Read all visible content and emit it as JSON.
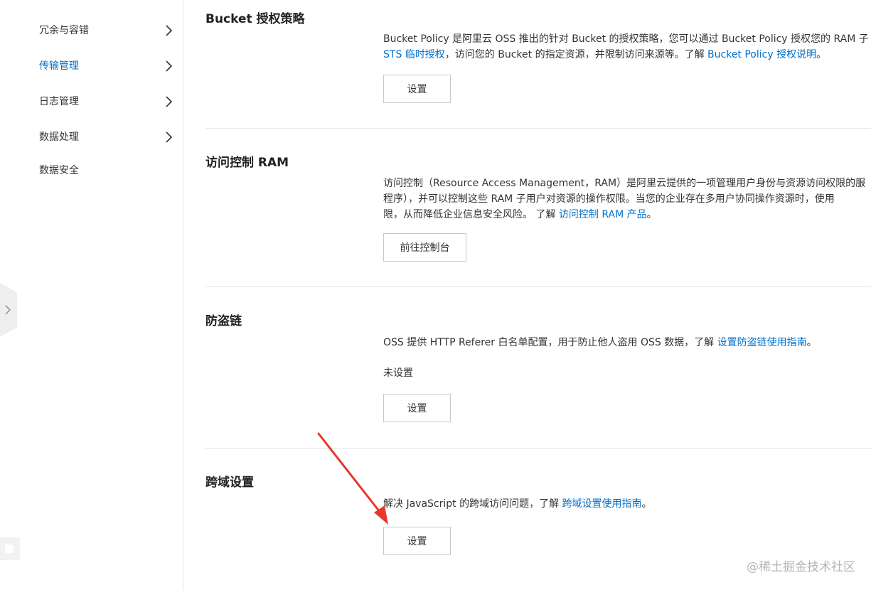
{
  "sidebar": {
    "items": [
      {
        "label": "冗余与容错",
        "has_chevron": true,
        "active": false
      },
      {
        "label": "传输管理",
        "has_chevron": true,
        "active": true
      },
      {
        "label": "日志管理",
        "has_chevron": true,
        "active": false
      },
      {
        "label": "数据处理",
        "has_chevron": true,
        "active": false
      },
      {
        "label": "数据安全",
        "has_chevron": false,
        "active": false
      }
    ]
  },
  "sections": {
    "bucket_policy": {
      "title": "Bucket 授权策略",
      "desc_line1": "Bucket Policy 是阿里云 OSS 推出的针对 Bucket 的授权策略，您可以通过 Bucket Policy 授权您的 RAM 子",
      "desc_link1": "STS 临时授权",
      "desc_line2": "，访问您的 Bucket 的指定资源，并限制访问来源等。了解 ",
      "desc_link2": "Bucket Policy 授权说明",
      "desc_end": "。",
      "button": "设置"
    },
    "ram": {
      "title": "访问控制 RAM",
      "desc_line1": "访问控制（Resource Access Management，RAM）是阿里云提供的一项管理用户身份与资源访问权限的服",
      "desc_line2": "程序），并可以控制这些 RAM 子用户对资源的操作权限。当您的企业存在多用户协同操作资源时，使用",
      "desc_line3": "限，从而降低企业信息安全风险。 了解 ",
      "desc_link": "访问控制 RAM 产品",
      "desc_end": "。",
      "button": "前往控制台"
    },
    "hotlink": {
      "title": "防盗链",
      "desc": "OSS 提供 HTTP Referer 白名单配置，用于防止他人盗用 OSS 数据，了解 ",
      "desc_link": "设置防盗链使用指南",
      "desc_end": "。",
      "status": "未设置",
      "button": "设置"
    },
    "cors": {
      "title": "跨域设置",
      "desc": "解决 JavaScript 的跨域访问问题，了解 ",
      "desc_link": "跨域设置使用指南",
      "desc_end": "。",
      "button": "设置"
    }
  },
  "annotation": {
    "arrow_color": "#e8372d"
  },
  "watermark": "@稀土掘金技术社区",
  "colors": {
    "link": "#0070cc",
    "active_nav": "#0070cc"
  }
}
